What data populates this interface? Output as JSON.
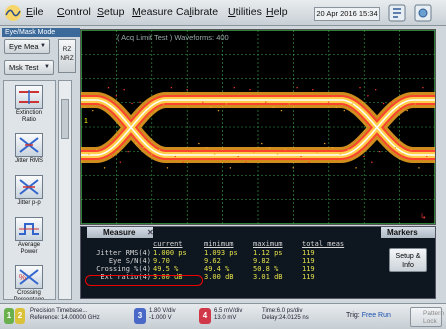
{
  "menubar": {
    "items": [
      {
        "key": "E",
        "rest": "ile"
      },
      {
        "key": "C",
        "rest": "ontrol"
      },
      {
        "key": "S",
        "rest": "etup"
      },
      {
        "key": "M",
        "rest": "easure"
      },
      {
        "key": "",
        "pre": "Ca",
        "under": "l",
        "rest": "ibrate"
      },
      {
        "key": "U",
        "rest": "tilities"
      },
      {
        "key": "H",
        "rest": "elp"
      }
    ],
    "datetime": "20 Apr 2016  15:34"
  },
  "left_panel": {
    "mode_label": "Eye/Mask Mode",
    "eye_mode_button": "Eye Mea",
    "mask_test_button": "Msk Test",
    "rz_button": "RZ NRZ",
    "measurements": [
      {
        "label": "Extinction Ratio",
        "icon": "extinction-ratio-icon"
      },
      {
        "label": "Jitter RMS",
        "icon": "jitter-rms-icon"
      },
      {
        "label": "Jitter p-p",
        "icon": "jitter-pp-icon"
      },
      {
        "label": "Average Power",
        "icon": "average-power-icon"
      },
      {
        "label": "Crossing Percentage",
        "icon": "crossing-icon"
      }
    ]
  },
  "display": {
    "acq_limit": "( Acq Limit Test )  Waveforms: 400",
    "channel_marker": "1"
  },
  "measure_panel": {
    "tab_label": "Measure",
    "markers_label": "Markers",
    "headers": [
      "current",
      "minimum",
      "maximum",
      "total meas"
    ],
    "rows": [
      {
        "name": "Jitter RMS(4)",
        "current": "1.000 ps",
        "min": "1.093 ps",
        "max": "1.12 ps",
        "total": "119"
      },
      {
        "name": "Eye S/N(4)",
        "current": "9.70",
        "min": "9.62",
        "max": "9.82",
        "total": "119"
      },
      {
        "name": "Crossing %(4)",
        "current": "49.5 %",
        "min": "49.4 %",
        "max": "50.8 %",
        "total": "119"
      },
      {
        "name": "Ext ratio(4)",
        "current": "3.00 dB",
        "min": "3.00 dB",
        "max": "3.01 dB",
        "total": "119"
      }
    ],
    "setup_info_button": "Setup & Info"
  },
  "statusbar": {
    "timebase_title": "Precision Timebase...",
    "timebase_ref": "Reference: 14.00000 GHz",
    "ch3_scale": "1.80 V/div",
    "ch3_offset": "-1.000 V",
    "ch4_scale": "6.5 mV/div",
    "ch4_offset": "13.0 mV",
    "time_scale": "Time:6.0 ps/div",
    "time_delay": "Delay:24.0125 ns",
    "trigger_label": "Trig:",
    "trigger_value": "Free Run",
    "pattern_label": "Pattern Lock",
    "chip_labels": [
      "1",
      "2",
      "3",
      "4"
    ]
  },
  "colors": {
    "eye_outer": "#f5a623",
    "eye_inner": "#ffd54a",
    "eye_hot": "#ff3b30",
    "eye_core": "#ffffff",
    "grid": "#3aa84b",
    "chip_green": "#6ab04c",
    "chip_yellow": "#d9c13a",
    "chip_red": "#d0384a",
    "chip_blue": "#4a68c8"
  }
}
